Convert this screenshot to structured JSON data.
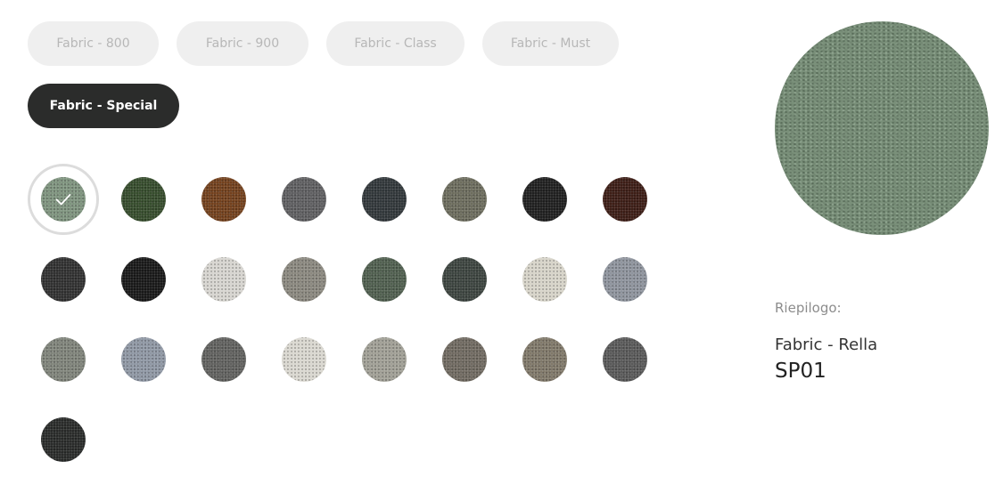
{
  "fabric_tabs": [
    {
      "label": "Fabric - 800",
      "active": false
    },
    {
      "label": "Fabric - 900",
      "active": false
    },
    {
      "label": "Fabric - Class",
      "active": false
    },
    {
      "label": "Fabric - Must",
      "active": false
    },
    {
      "label": "Fabric - Special",
      "active": true
    }
  ],
  "swatches": [
    {
      "color": "#7d927d",
      "selected": true
    },
    {
      "color": "#334a2a"
    },
    {
      "color": "#713e1a"
    },
    {
      "color": "#5e5e60"
    },
    {
      "color": "#2f3538"
    },
    {
      "color": "#6b6b5c"
    },
    {
      "color": "#1c1c1c"
    },
    {
      "color": "#3a1a12"
    },
    {
      "color": "#2e2e2e"
    },
    {
      "color": "#151515"
    },
    {
      "color": "#d6d4cf"
    },
    {
      "color": "#8a877e"
    },
    {
      "color": "#4e5d4d"
    },
    {
      "color": "#3a423d"
    },
    {
      "color": "#d6d3c8"
    },
    {
      "color": "#8d939c"
    },
    {
      "color": "#7e8279"
    },
    {
      "color": "#8e96a3"
    },
    {
      "color": "#5f605d"
    },
    {
      "color": "#d9d7cf"
    },
    {
      "color": "#a09f95"
    },
    {
      "color": "#6f695f"
    },
    {
      "color": "#7f7768"
    },
    {
      "color": "#585858"
    },
    {
      "color": "#262827"
    }
  ],
  "summary": {
    "label": "Riepilogo:",
    "fabric": "Fabric - Rella",
    "code": "SP01"
  },
  "colors": {
    "active_tab": "#2b2c2b",
    "inactive_tab": "#efefef",
    "selected_ring": "#dcdcdc"
  },
  "icons": {
    "check": "check-icon"
  }
}
